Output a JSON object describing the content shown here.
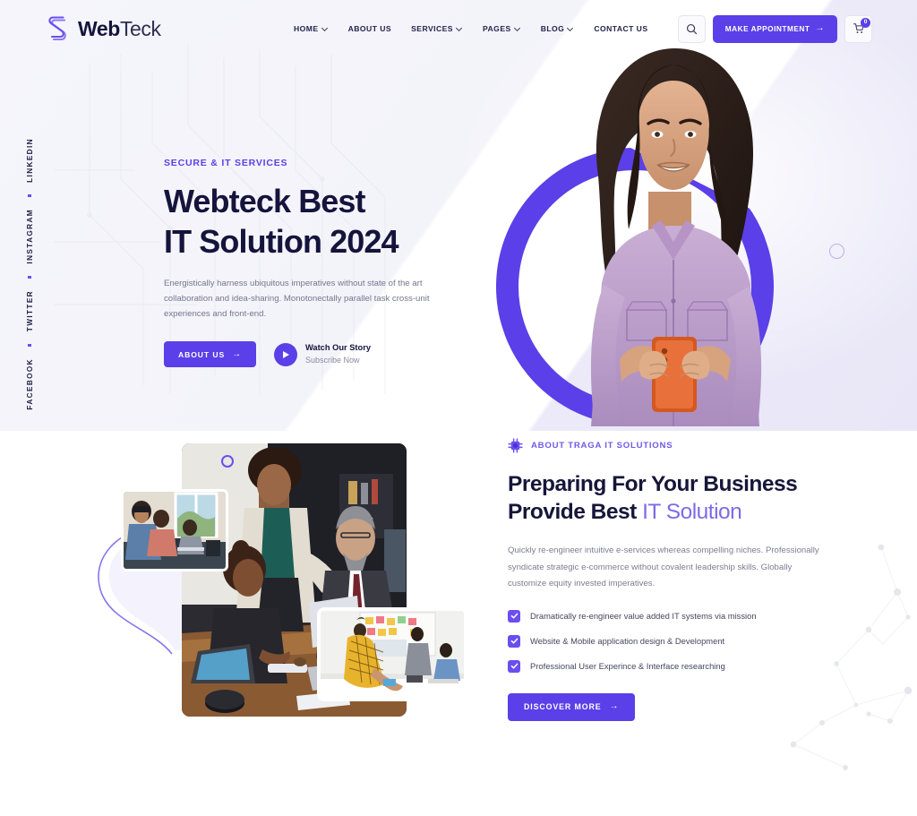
{
  "header": {
    "brand": {
      "part1": "Web",
      "part2": "Teck",
      "logo_icon": "webteck-s-logo-icon"
    },
    "nav": [
      {
        "label": "HOME",
        "has_dropdown": true
      },
      {
        "label": "ABOUT US",
        "has_dropdown": false
      },
      {
        "label": "SERVICES",
        "has_dropdown": true
      },
      {
        "label": "PAGES",
        "has_dropdown": true
      },
      {
        "label": "BLOG",
        "has_dropdown": true
      },
      {
        "label": "CONTACT US",
        "has_dropdown": false
      }
    ],
    "search_icon": "search-icon",
    "appointment_button": "MAKE APPOINTMENT",
    "appointment_arrow": "→",
    "cart_icon": "shopping-cart-icon",
    "cart_count": "0"
  },
  "social": {
    "items": [
      "LINKEDIN",
      "INSTAGRAM",
      "TWITTER",
      "FACEBOOK"
    ]
  },
  "hero": {
    "eyebrow": "SECURE & IT SERVICES",
    "title_line1": "Webteck Best",
    "title_line2": "IT Solution 2024",
    "description": "Energistically harness ubiquitous imperatives without state of the art collaboration and idea-sharing. Monotonectally parallel task cross-unit experiences and front-end.",
    "cta_label": "ABOUT US",
    "cta_arrow": "→",
    "play_icon": "play-button-icon",
    "play_title": "Watch Our Story",
    "play_subtitle": "Subscribe Now",
    "image_alt": "smiling-woman-holding-phone-photo"
  },
  "about": {
    "eyebrow_icon": "cpu-chip-icon",
    "eyebrow": "ABOUT TRAGA IT SOLUTIONS",
    "title_line1": "Preparing For Your Business",
    "title_line2_dark": "Provide Best ",
    "title_line2_accent": "IT Solution",
    "description": "Quickly re-engineer intuitive e-services whereas compelling niches. Professionally syndicate strategic e-commerce without covalent leadership skills. Globally customize equity invested imperatives.",
    "checklist": [
      "Dramatically re-engineer value added IT systems via mission",
      "Website & Mobile application design & Development",
      "Professional User Experince & Interface researching"
    ],
    "cta_label": "DISCOVER MORE",
    "cta_arrow": "→",
    "images": {
      "main_alt": "office-team-meeting-photo",
      "top_left_alt": "colleagues-at-window-desk-photo",
      "bottom_right_alt": "whiteboard-brainstorm-session-photo"
    }
  },
  "theme": {
    "primary": "#5b3fe8",
    "primary_light": "#7b6be8",
    "heading": "#14143c",
    "body_text": "#7d7d93",
    "hero_bg": "#f4f4fa"
  }
}
